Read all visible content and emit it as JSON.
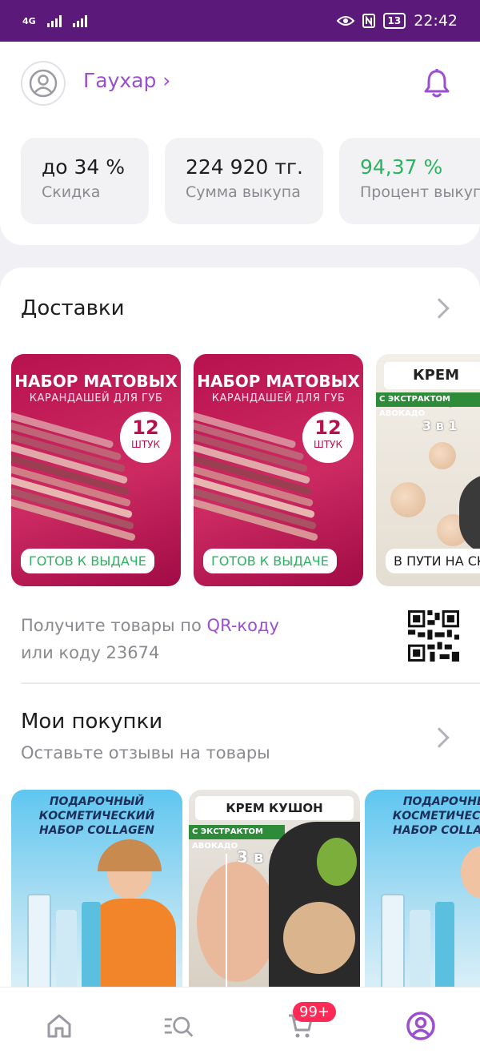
{
  "status_bar": {
    "network": "4G",
    "battery": "13",
    "time": "22:42"
  },
  "profile": {
    "name": "Гаухар ›"
  },
  "stats": [
    {
      "value": "до 34 %",
      "label": "Скидка",
      "color": "#1d1d1f"
    },
    {
      "value": "224 920 тг.",
      "label": "Сумма выкупа",
      "color": "#1d1d1f"
    },
    {
      "value": "94,37 %",
      "label": "Процент выкупа",
      "color": "#2ab360"
    }
  ],
  "deliveries": {
    "title": "Доставки",
    "items": [
      {
        "headline": "НАБОР МАТОВЫХ",
        "subline": "КАРАНДАШЕЙ ДЛЯ ГУБ",
        "count": "12",
        "count_unit": "ШТУК",
        "status": "ГОТОВ К ВЫДАЧЕ"
      },
      {
        "headline": "НАБОР МАТОВЫХ",
        "subline": "КАРАНДАШЕЙ ДЛЯ ГУБ",
        "count": "12",
        "count_unit": "ШТУК",
        "status": "ГОТОВ К ВЫДАЧЕ"
      },
      {
        "headline": "КРЕМ КУШОН",
        "subline": "С ЭКСТРАКТОМ АВОКАДО",
        "count": "3 в 1",
        "status": "В ПУТИ НА СКЛАД"
      }
    ],
    "qr_line1_prefix": "Получите товары по ",
    "qr_line1_link": "QR-коду",
    "qr_line2": "или коду 23674"
  },
  "purchases": {
    "title": "Мои покупки",
    "subtitle": "Оставьте отзывы на товары",
    "items": [
      {
        "headline": "ПОДАРОЧНЫЙ КОСМЕТИЧЕСКИЙ НАБОР COLLAGEN"
      },
      {
        "headline": "КРЕМ КУШОН",
        "subline": "С ЭКСТРАКТОМ АВОКАДО",
        "tag": "3 в 1"
      },
      {
        "headline": "ПОДАРОЧНЫЙ КОСМЕТИЧЕСКИЙ НАБОР COLLAGEN"
      }
    ]
  },
  "nav": {
    "cart_badge": "99+",
    "active": "profile"
  },
  "colors": {
    "brand_purple": "#5b1a7a",
    "accent_purple": "#9a4fcf",
    "green": "#2ab360",
    "badge_red": "#ff2a55"
  }
}
